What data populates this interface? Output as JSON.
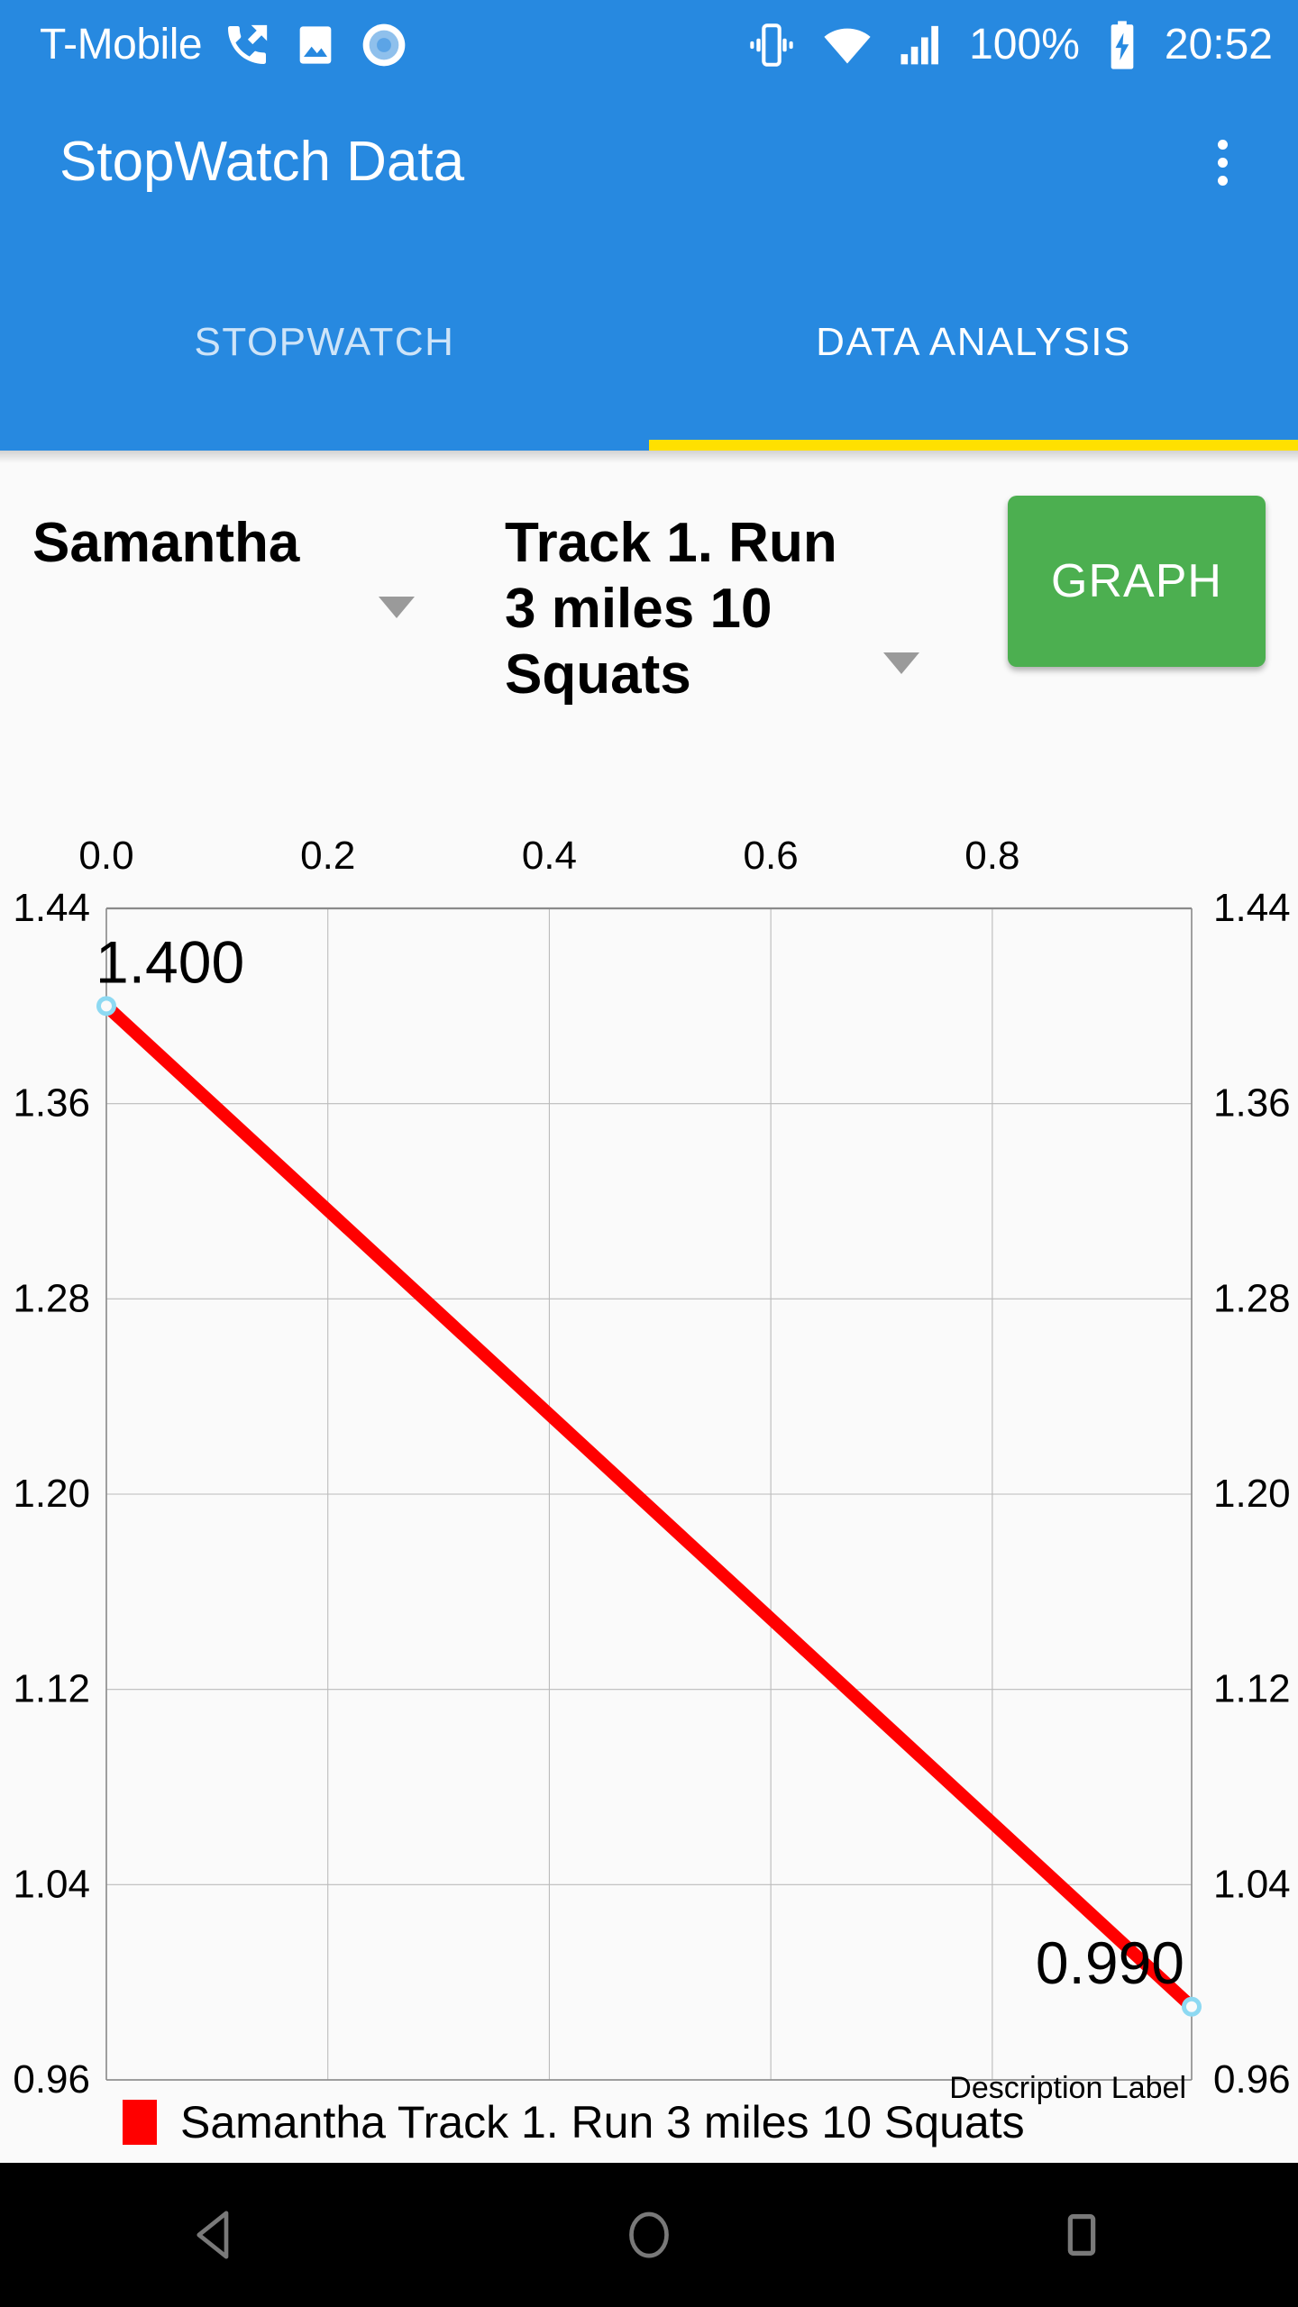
{
  "status_bar": {
    "carrier": "T-Mobile",
    "battery_percent": "100%",
    "time": "20:52",
    "icons": [
      "missed-call-icon",
      "image-icon",
      "record-icon",
      "vibrate-icon",
      "wifi-icon",
      "signal-icon",
      "battery-charging-icon"
    ]
  },
  "app_bar": {
    "title": "StopWatch Data",
    "overflow_label": "overflow-menu"
  },
  "tabs": [
    {
      "label": "STOPWATCH",
      "active": false
    },
    {
      "label": "DATA ANALYSIS",
      "active": true
    }
  ],
  "controls": {
    "athlete_spinner_value": "Samantha",
    "workout_spinner_value": "Track 1. Run 3 miles 10 Squats",
    "graph_button_label": "GRAPH"
  },
  "colors": {
    "app_bar": "#2789E0",
    "tab_indicator": "#FFE000",
    "graph_button": "#4CAF50",
    "series_line": "#FF0000",
    "marker": "#8DD9F2",
    "background": "#FAFAFA"
  },
  "chart_data": {
    "type": "line",
    "title": "",
    "xlabel": "",
    "ylabel": "",
    "description_label": "Description Label",
    "xlim": [
      0.0,
      0.98
    ],
    "ylim": [
      0.96,
      1.44
    ],
    "x_ticks": [
      "0.0",
      "0.2",
      "0.4",
      "0.6",
      "0.8"
    ],
    "x_tick_values": [
      0.0,
      0.2,
      0.4,
      0.6,
      0.8
    ],
    "x_axis_position": "top",
    "y_ticks": [
      "1.44",
      "1.36",
      "1.28",
      "1.20",
      "1.12",
      "1.04",
      "0.96"
    ],
    "y_tick_values": [
      1.44,
      1.36,
      1.28,
      1.2,
      1.12,
      1.04,
      0.96
    ],
    "y_axis_both_sides": true,
    "grid": true,
    "legend_position": "bottom-left",
    "series": [
      {
        "name": "Samantha Track 1. Run 3 miles 10 Squats",
        "color": "#FF0000",
        "marker_color": "#8DD9F2",
        "x": [
          0.0,
          0.98
        ],
        "y": [
          1.4,
          0.99
        ],
        "point_labels": [
          "1.400",
          "0.990"
        ]
      }
    ]
  },
  "nav_bar": {
    "back_label": "back",
    "home_label": "home",
    "recents_label": "recents"
  }
}
